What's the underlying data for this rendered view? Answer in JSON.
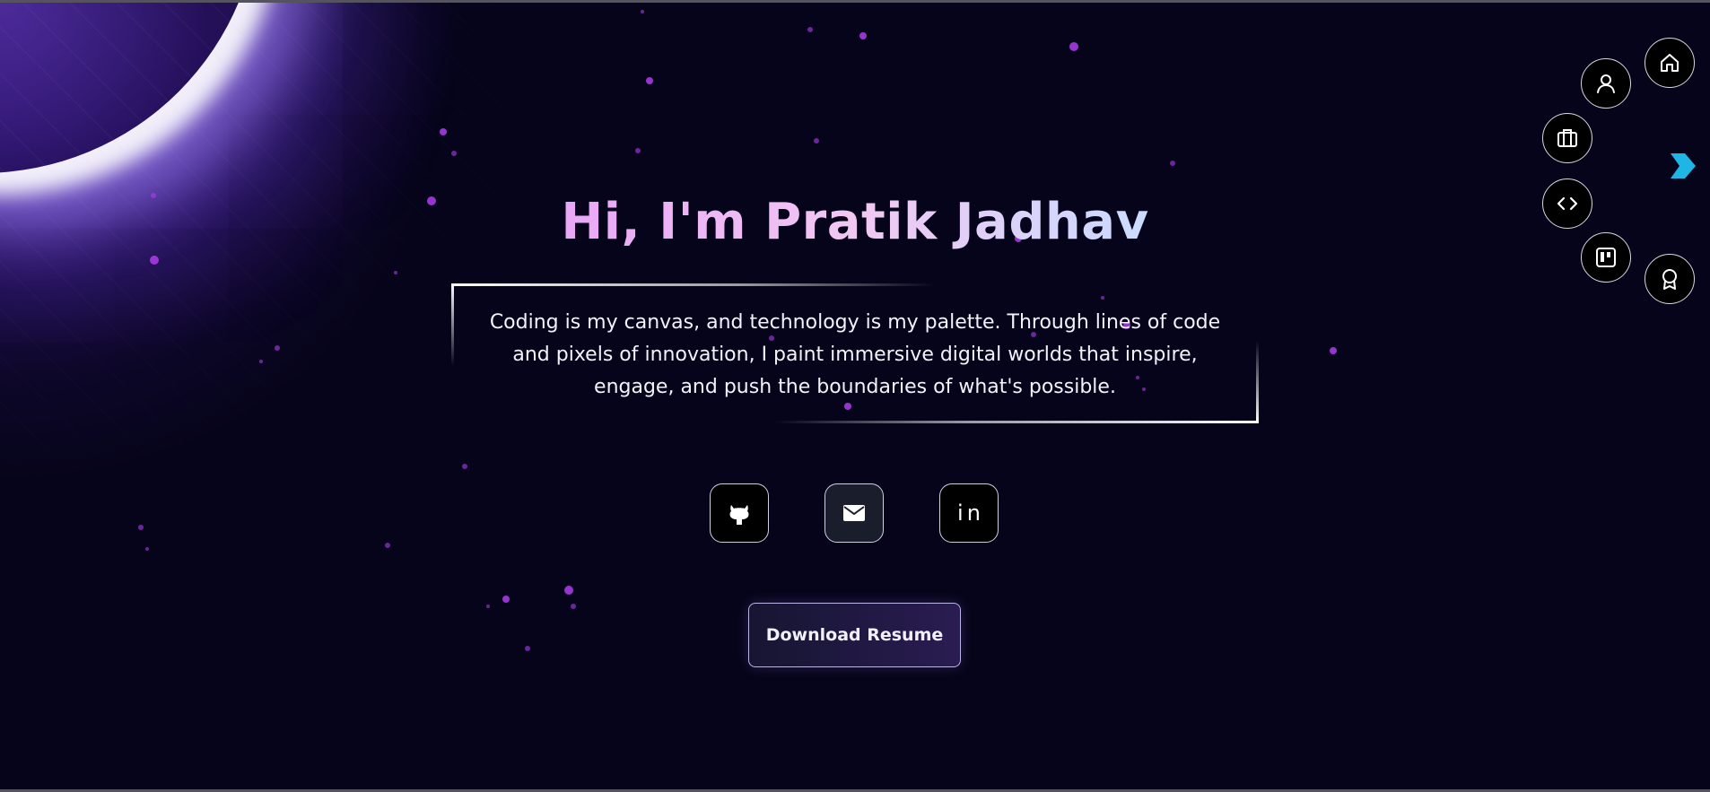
{
  "hero": {
    "title": "Hi, I'm Pratik Jadhav",
    "description": "Coding is my canvas, and technology is my palette. Through lines of code and pixels of innovation, I paint immersive digital worlds that inspire, engage, and push the boundaries of what's possible."
  },
  "socials": [
    {
      "name": "github",
      "icon": "github-icon"
    },
    {
      "name": "email",
      "icon": "mail-icon"
    },
    {
      "name": "linkedin",
      "icon": "linkedin-icon",
      "glyph": "in"
    }
  ],
  "actions": {
    "download_resume_label": "Download Resume"
  },
  "nav": {
    "items": [
      {
        "id": "home",
        "icon": "home-icon"
      },
      {
        "id": "about",
        "icon": "user-icon"
      },
      {
        "id": "experience",
        "icon": "briefcase-icon"
      },
      {
        "id": "skills",
        "icon": "code-icon"
      },
      {
        "id": "projects",
        "icon": "kanban-icon"
      },
      {
        "id": "awards",
        "icon": "award-icon"
      }
    ],
    "toggle_icon": "chevron-right-icon"
  },
  "colors": {
    "background": "#06041a",
    "title_gradient_start": "#e9a6f7",
    "title_gradient_end": "#c9dbff",
    "star": "#b13cf0",
    "nav_toggle": "#1fb6e6",
    "button_border": "#b9b4e6"
  }
}
